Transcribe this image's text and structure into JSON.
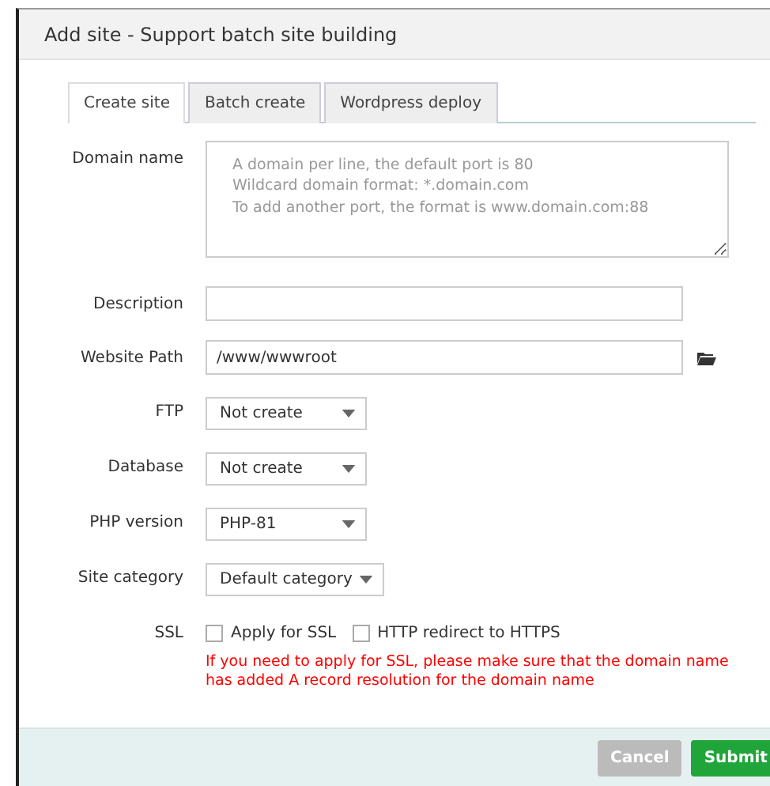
{
  "dialog": {
    "title": "Add site - Support batch site building"
  },
  "tabs": [
    {
      "label": "Create site",
      "selected": true
    },
    {
      "label": "Batch create",
      "selected": false
    },
    {
      "label": "Wordpress deploy",
      "selected": false
    }
  ],
  "form": [
    {
      "kind": "textarea",
      "label": "Domain name",
      "placeholder": "A domain per line, the default port is 80\nWildcard domain format: *.domain.com\nTo add another port, the format is www.domain.com:88"
    },
    {
      "kind": "input",
      "label": "Description"
    },
    {
      "kind": "path",
      "label": "Website Path",
      "value": "/www/wwwroot"
    },
    {
      "kind": "select",
      "label": "FTP",
      "value": "Not create"
    },
    {
      "kind": "select",
      "label": "Database",
      "value": "Not create"
    },
    {
      "kind": "select",
      "label": "PHP version",
      "value": "PHP-81"
    },
    {
      "kind": "select",
      "label": "Site category",
      "value": "Default category"
    }
  ],
  "ssl": {
    "label": "SSL",
    "options": [
      {
        "label": "Apply for SSL",
        "checked": false
      },
      {
        "label": "HTTP redirect to HTTPS",
        "checked": false
      }
    ],
    "warning": "If you need to apply for SSL, please make sure that the domain name has added A record resolution for the domain name"
  },
  "buttons": [
    {
      "label": "Cancel",
      "kind": "secondary"
    },
    {
      "label": "Submit",
      "kind": "primary"
    }
  ]
}
